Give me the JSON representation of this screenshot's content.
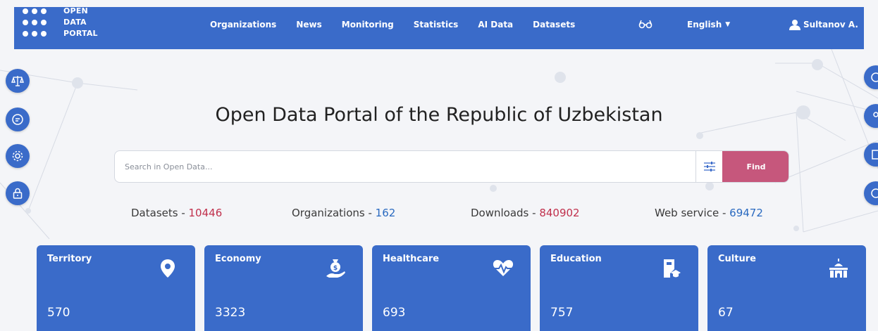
{
  "header": {
    "logo_lines": [
      "OPEN",
      "DATA",
      "PORTAL"
    ],
    "nav": [
      "Organizations",
      "News",
      "Monitoring",
      "Statistics",
      "AI Data",
      "Datasets"
    ],
    "language": "English",
    "user": "Sultanov A."
  },
  "title": "Open Data Portal of the Republic of Uzbekistan",
  "search": {
    "placeholder": "Search in Open Data...",
    "find_label": "Find"
  },
  "stats": [
    {
      "label": "Datasets - ",
      "value": "10446"
    },
    {
      "label": "Organizations - ",
      "value": "162"
    },
    {
      "label": "Downloads - ",
      "value": "840902"
    },
    {
      "label": "Web service - ",
      "value": "69472"
    }
  ],
  "cards": [
    {
      "title": "Territory",
      "value": "570",
      "icon": "location-pin-icon"
    },
    {
      "title": "Economy",
      "value": "3323",
      "icon": "money-bag-hand-icon"
    },
    {
      "title": "Healthcare",
      "value": "693",
      "icon": "heartbeat-icon"
    },
    {
      "title": "Education",
      "value": "757",
      "icon": "book-graduation-icon"
    },
    {
      "title": "Culture",
      "value": "67",
      "icon": "mosque-icon"
    }
  ],
  "colors": {
    "primary": "#3a6bc9",
    "accent": "#c6577c",
    "value_red": "#c0304c",
    "value_blue": "#2a6ac0"
  }
}
